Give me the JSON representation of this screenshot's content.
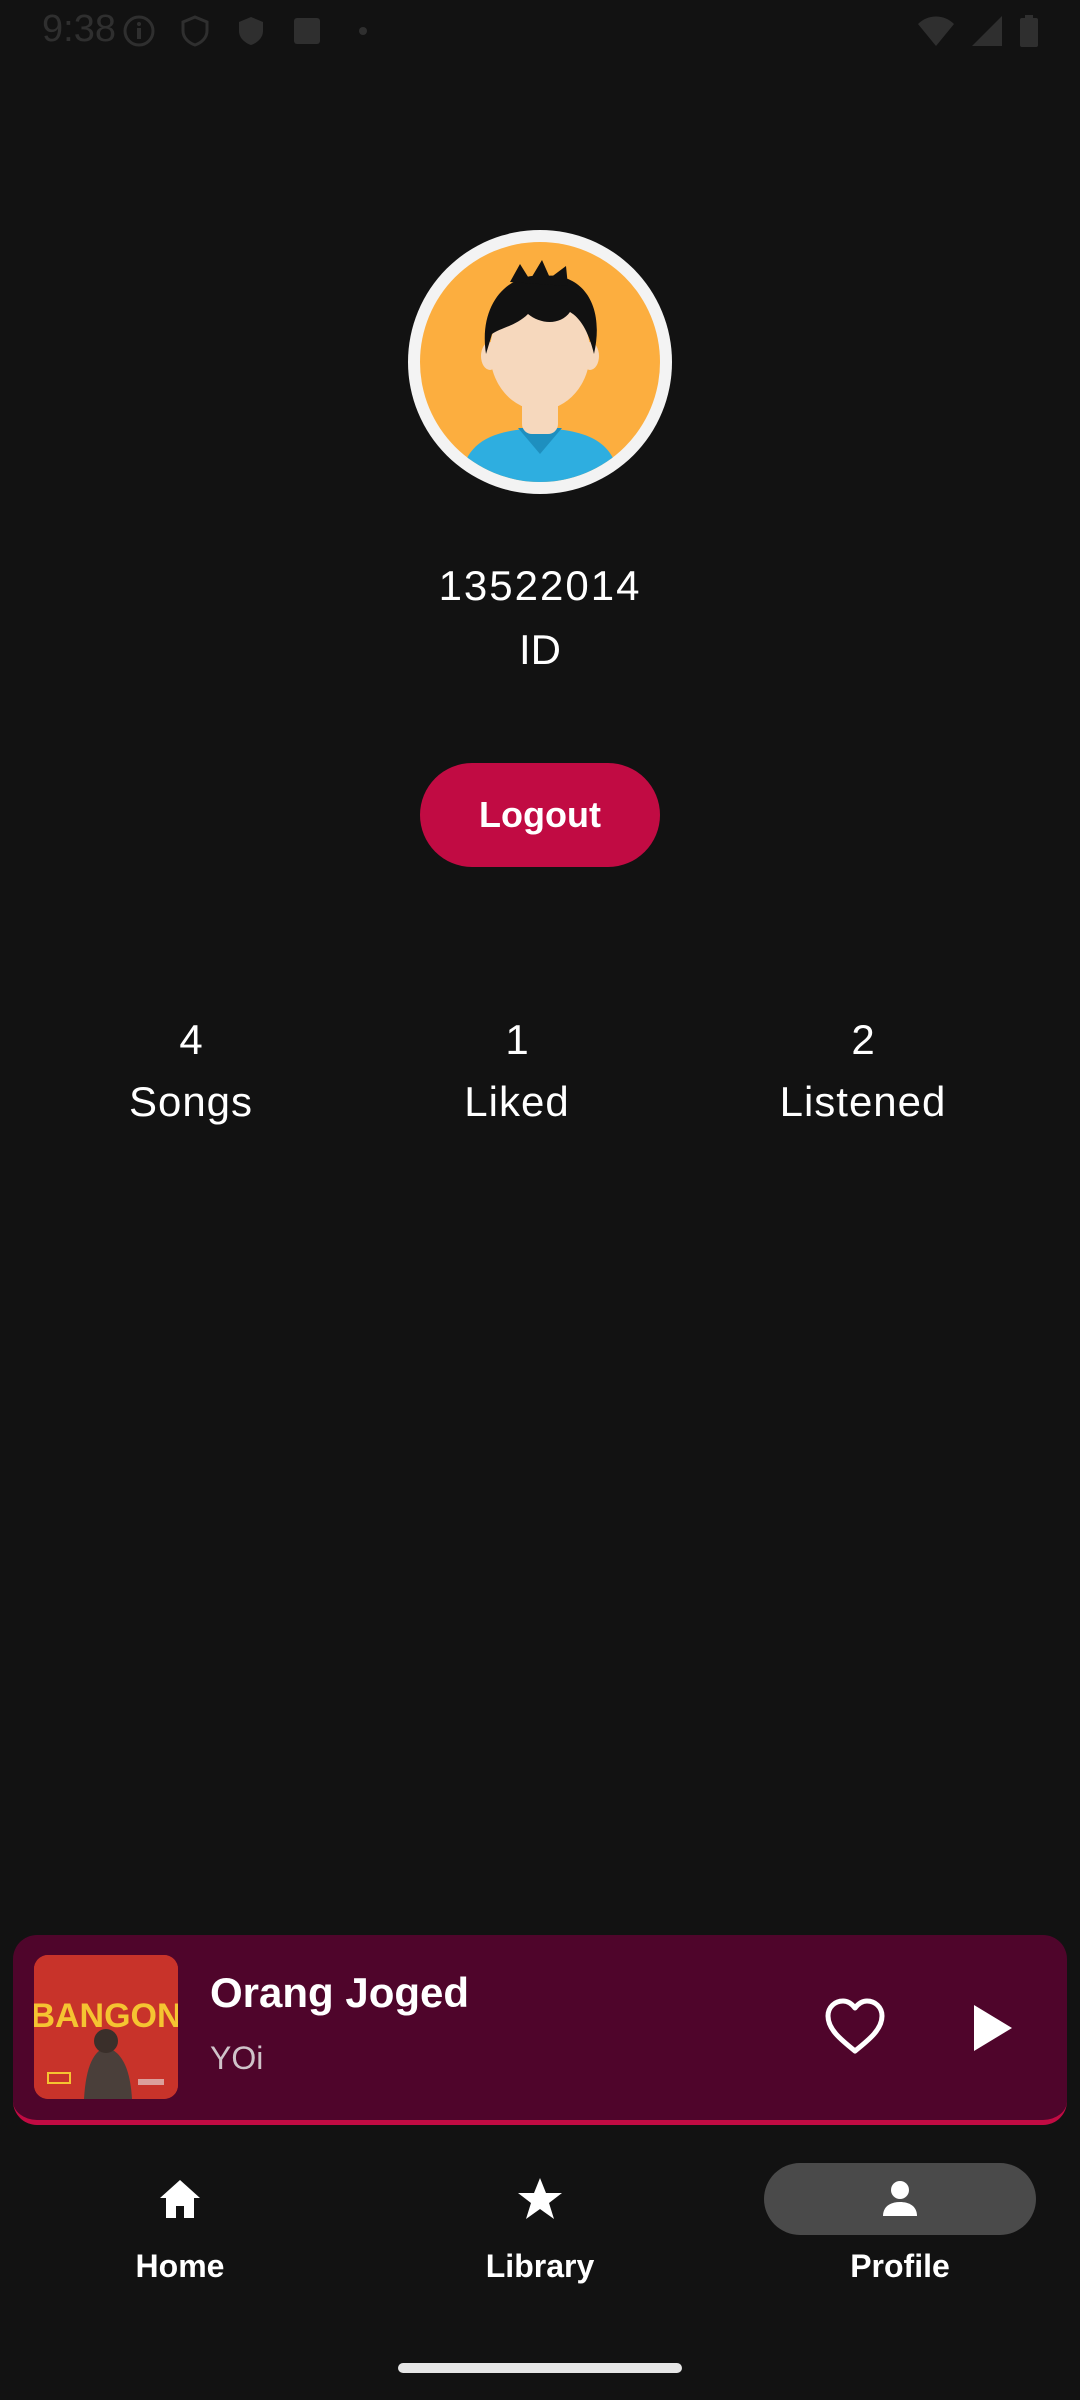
{
  "status_bar": {
    "time": "9:38"
  },
  "profile": {
    "user_id": "13522014",
    "id_label": "ID",
    "logout_label": "Logout"
  },
  "stats": [
    {
      "value": "4",
      "label": "Songs"
    },
    {
      "value": "1",
      "label": "Liked"
    },
    {
      "value": "2",
      "label": "Listened"
    }
  ],
  "mini_player": {
    "title": "Orang Joged",
    "artist": "YOi",
    "album_art_text": "BANGON",
    "liked": false,
    "playing": false
  },
  "bottom_nav": {
    "items": [
      {
        "label": "Home",
        "icon": "home-icon"
      },
      {
        "label": "Library",
        "icon": "star-icon"
      },
      {
        "label": "Profile",
        "icon": "person-icon",
        "active": true
      }
    ]
  },
  "colors": {
    "background": "#121212",
    "accent": "#c10b43",
    "player_bg": "#4f052b",
    "active_pill": "#4a4a4a"
  }
}
